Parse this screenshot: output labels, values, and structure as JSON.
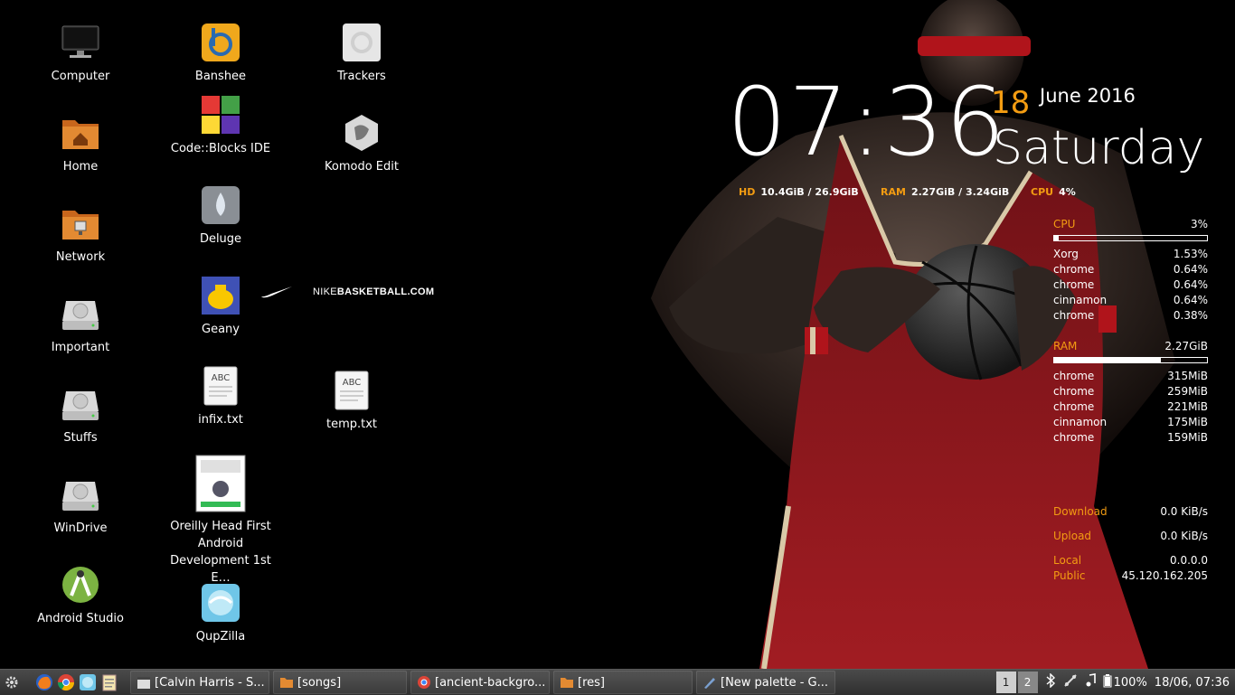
{
  "desktop_icons": [
    {
      "label": "Computer",
      "icon": "monitor-icon"
    },
    {
      "label": "Home",
      "icon": "home-folder-icon"
    },
    {
      "label": "Network",
      "icon": "network-folder-icon"
    },
    {
      "label": "Important",
      "icon": "drive-icon"
    },
    {
      "label": "Stuffs",
      "icon": "drive-icon"
    },
    {
      "label": "WinDrive",
      "icon": "drive-icon"
    },
    {
      "label": "Android Studio",
      "icon": "android-studio-icon"
    },
    {
      "label": "Banshee",
      "icon": "banshee-icon"
    },
    {
      "label": "Code::Blocks IDE",
      "icon": "codeblocks-icon"
    },
    {
      "label": "Deluge",
      "icon": "deluge-icon"
    },
    {
      "label": "Geany",
      "icon": "geany-icon"
    },
    {
      "label": "infix.txt",
      "icon": "text-file-icon"
    },
    {
      "label": "Oreilly Head First Android Development 1st E…",
      "icon": "book-cover-icon"
    },
    {
      "label": "QupZilla",
      "icon": "qupzilla-icon"
    },
    {
      "label": "Trackers",
      "icon": "trackers-icon"
    },
    {
      "label": "Komodo Edit",
      "icon": "komodo-icon"
    },
    {
      "label": "temp.txt",
      "icon": "text-file-icon"
    }
  ],
  "wallpaper": {
    "brand_light": "NIKE",
    "brand_bold": "BASKETBALL",
    "brand_suffix": ".COM"
  },
  "clock": {
    "time": "07:36",
    "day": "18",
    "month_year": "June 2016",
    "weekday": "Saturday"
  },
  "summary": {
    "hd_label": "HD",
    "hd_value": "10.4GiB / 26.9GiB",
    "ram_label": "RAM",
    "ram_value": "2.27GiB / 3.24GiB",
    "cpu_label": "CPU",
    "cpu_value": "4%"
  },
  "conky": {
    "cpu_label": "CPU",
    "cpu_value": "3%",
    "cpu_fraction": 0.03,
    "cpu_procs": [
      {
        "name": "Xorg",
        "value": "1.53%"
      },
      {
        "name": "chrome",
        "value": "0.64%"
      },
      {
        "name": "chrome",
        "value": "0.64%"
      },
      {
        "name": "cinnamon",
        "value": "0.64%"
      },
      {
        "name": "chrome",
        "value": "0.38%"
      }
    ],
    "ram_label": "RAM",
    "ram_value": "2.27GiB",
    "ram_fraction": 0.7,
    "ram_procs": [
      {
        "name": "chrome",
        "value": "315MiB"
      },
      {
        "name": "chrome",
        "value": "259MiB"
      },
      {
        "name": "chrome",
        "value": "221MiB"
      },
      {
        "name": "cinnamon",
        "value": "175MiB"
      },
      {
        "name": "chrome",
        "value": "159MiB"
      }
    ],
    "download_label": "Download",
    "download_value": "0.0 KiB/s",
    "upload_label": "Upload",
    "upload_value": "0.0 KiB/s",
    "local_label": "Local",
    "local_value": "0.0.0.0",
    "public_label": "Public",
    "public_value": "45.120.162.205"
  },
  "taskbar": {
    "tasks": [
      {
        "label": "[Calvin Harris - S...",
        "icon": "clapper-icon"
      },
      {
        "label": "[songs]",
        "icon": "folder-icon"
      },
      {
        "label": "[ancient-backgro...",
        "icon": "chrome-icon"
      },
      {
        "label": "[res]",
        "icon": "folder-icon"
      },
      {
        "label": "[New palette - G...",
        "icon": "gimp-icon"
      }
    ],
    "workspaces": [
      "1",
      "2"
    ],
    "battery": "100%",
    "datetime": "18/06, 07:36"
  },
  "colors": {
    "accent": "#f39c12",
    "jersey": "#8e1a1f"
  }
}
